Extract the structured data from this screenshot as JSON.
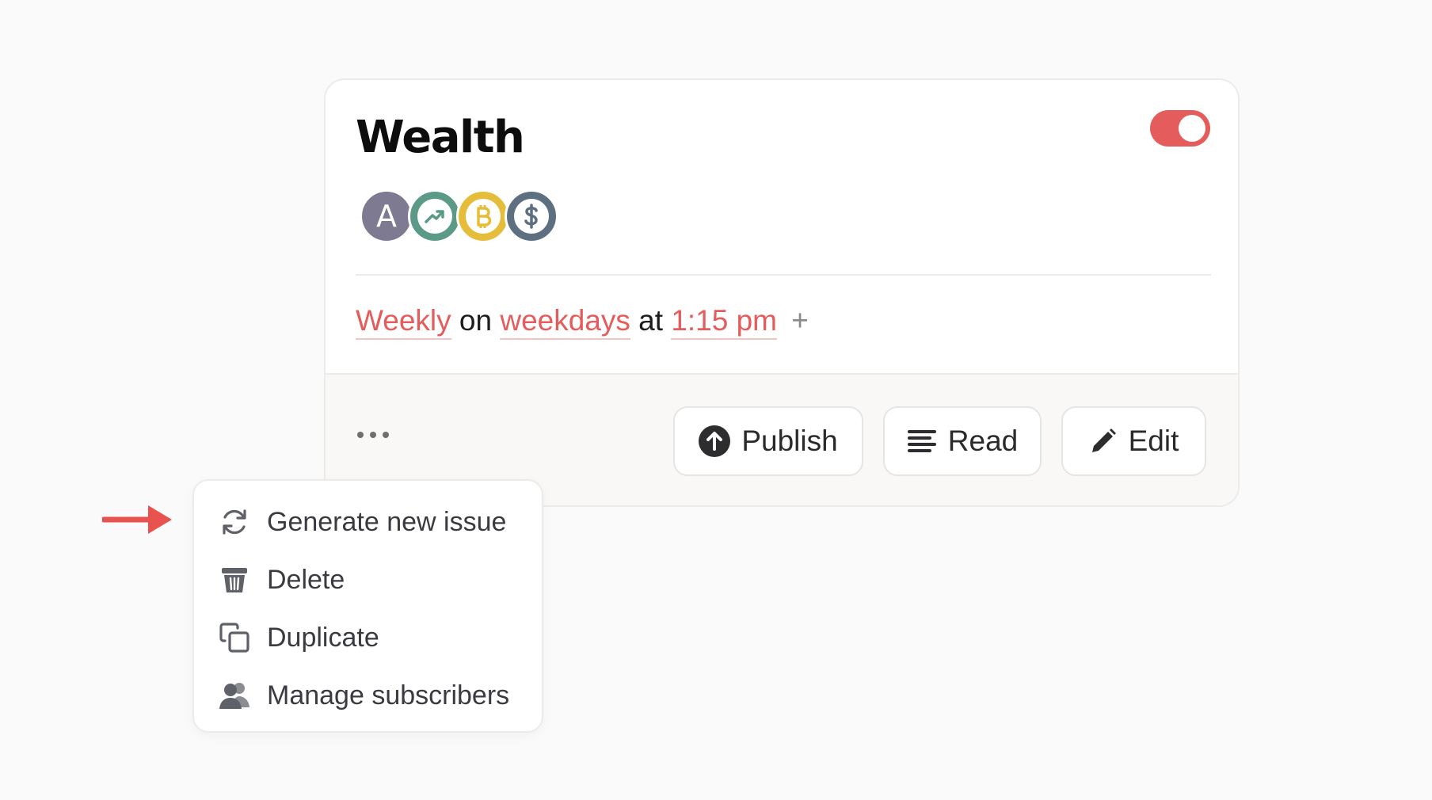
{
  "card": {
    "title": "Wealth",
    "toggle_on": true,
    "sources": [
      {
        "icon": "letter-a-icon",
        "letter": "A",
        "color": "#7d7a92"
      },
      {
        "icon": "trending-up-icon",
        "color": "#5a9a86"
      },
      {
        "icon": "bitcoin-icon",
        "color": "#e5bd3a"
      },
      {
        "icon": "dollar-icon",
        "color": "#5d6f80"
      }
    ],
    "schedule": {
      "frequency": "Weekly",
      "on_word": "on",
      "days": "weekdays",
      "at_word": "at",
      "time": "1:15 pm",
      "add_symbol": "+"
    },
    "footer": {
      "more_icon": "ellipsis-icon",
      "publish_label": "Publish",
      "read_label": "Read",
      "edit_label": "Edit"
    }
  },
  "menu": {
    "items": [
      {
        "label": "Generate new issue",
        "icon": "refresh-icon"
      },
      {
        "label": "Delete",
        "icon": "trash-icon"
      },
      {
        "label": "Duplicate",
        "icon": "copy-icon"
      },
      {
        "label": "Manage subscribers",
        "icon": "users-icon"
      }
    ]
  },
  "colors": {
    "accent": "#e45c5c",
    "arrow": "#e8534f"
  }
}
